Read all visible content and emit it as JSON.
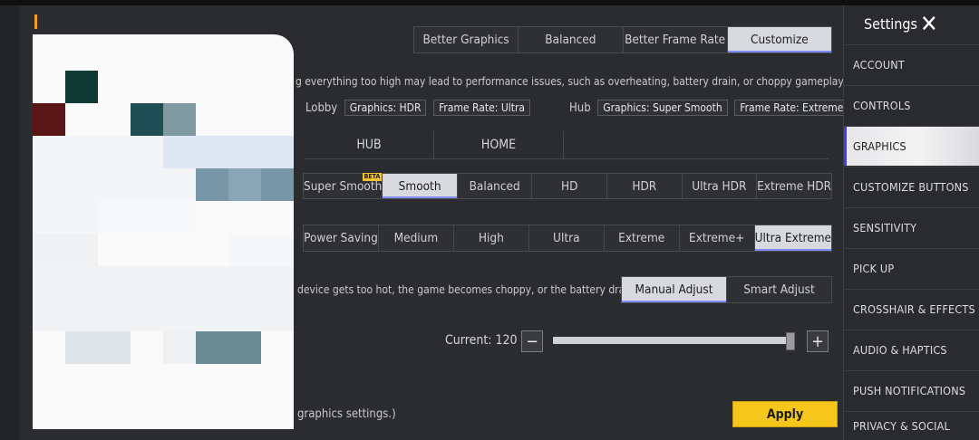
{
  "presets": {
    "options": [
      "Better Graphics",
      "Balanced",
      "Better Frame Rate",
      "Customize"
    ],
    "selected": "Customize"
  },
  "warning_text": "g everything too high may lead to performance issues, such as overheating, battery drain, or choppy gameplay.",
  "lobby": {
    "label": "Lobby",
    "graphics": "Graphics: HDR",
    "frame_rate": "Frame Rate: Ultra"
  },
  "hub": {
    "label": "Hub",
    "graphics": "Graphics: Super Smooth",
    "frame_rate": "Frame Rate: Extreme"
  },
  "scene_tabs": [
    "HUB",
    "HOME"
  ],
  "graphics_options": {
    "options": [
      "Super Smooth",
      "Smooth",
      "Balanced",
      "HD",
      "HDR",
      "Ultra HDR",
      "Extreme HDR"
    ],
    "selected": "Smooth",
    "beta_badge": "BETA"
  },
  "frame_rate_options": {
    "options": [
      "Power Saving",
      "Medium",
      "High",
      "Ultra",
      "Extreme",
      "Extreme+",
      "Ultra Extreme"
    ],
    "selected": "Ultra Extreme"
  },
  "adjust": {
    "text": "device gets too hot, the game becomes choppy, or the battery drains t",
    "options": [
      "Manual Adjust",
      "Smart Adjust"
    ],
    "selected": "Manual Adjust"
  },
  "frame_limit": {
    "label": "Current: 120",
    "minus": "−",
    "plus": "+",
    "value": 120,
    "fill_percent": 98
  },
  "reset_text": "graphics settings.)",
  "apply_label": "Apply",
  "sidebar": {
    "title": "Settings",
    "items": [
      "ACCOUNT",
      "CONTROLS",
      "GRAPHICS",
      "CUSTOMIZE BUTTONS",
      "SENSITIVITY",
      "PICK UP",
      "CROSSHAIR & EFFECTS",
      "AUDIO & HAPTICS",
      "PUSH NOTIFICATIONS",
      "PRIVACY & SOCIAL"
    ],
    "selected": "GRAPHICS"
  },
  "colors": {
    "accent_yellow": "#f5c61c",
    "selected_option": "#d8dadf",
    "sidebar_marker": "#3a3ff0"
  }
}
